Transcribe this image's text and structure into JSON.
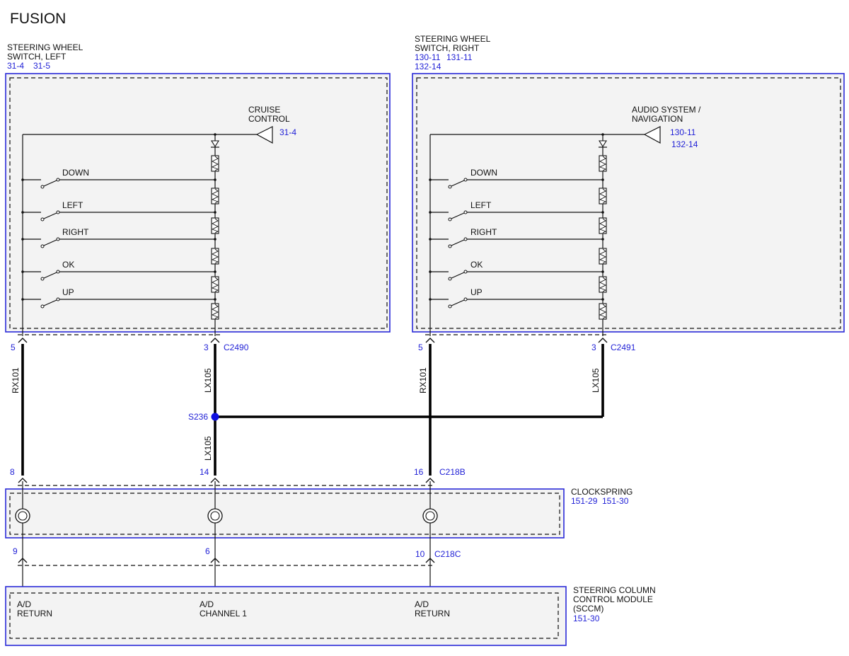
{
  "title": "FUSION",
  "colors": {
    "module_border": "#2a2ad8",
    "ref_text": "#1f1fd6",
    "splice": "#1010e0",
    "wire": "#000000",
    "module_fill": "#f3f3f3"
  },
  "left_switch": {
    "name_line1": "STEERING WHEEL",
    "name_line2": "SWITCH, LEFT",
    "refs": [
      "31-4",
      "31-5"
    ],
    "output_label_line1": "CRUISE",
    "output_label_line2": "CONTROL",
    "output_ref": "31-4",
    "buttons": [
      "DOWN",
      "LEFT",
      "RIGHT",
      "OK",
      "UP"
    ],
    "pin_return": "5",
    "pin_signal": "3",
    "connector": "C2490"
  },
  "right_switch": {
    "name_line1": "STEERING WHEEL",
    "name_line2": "SWITCH, RIGHT",
    "refs_line1": [
      "130-11",
      "131-11"
    ],
    "refs_line2": [
      "132-14"
    ],
    "output_label_line1": "AUDIO SYSTEM /",
    "output_label_line2": "NAVIGATION",
    "output_refs": [
      "130-11",
      "132-14"
    ],
    "buttons": [
      "DOWN",
      "LEFT",
      "RIGHT",
      "OK",
      "UP"
    ],
    "pin_return": "5",
    "pin_signal": "3",
    "connector": "C2491"
  },
  "circuits": {
    "return": "RX101",
    "signal": "LX105"
  },
  "splice": {
    "name": "S236"
  },
  "c218b": {
    "connector": "C218B",
    "pins": [
      "8",
      "14",
      "16"
    ]
  },
  "clockspring": {
    "name": "CLOCKSPRING",
    "refs": [
      "151-29",
      "151-30"
    ]
  },
  "c218c": {
    "connector": "C218C",
    "pins": [
      "9",
      "6",
      "10"
    ]
  },
  "sccm": {
    "name_lines": [
      "STEERING COLUMN",
      "CONTROL MODULE",
      "(SCCM)"
    ],
    "ref": "151-30",
    "inputs": [
      {
        "line1": "A/D",
        "line2": "RETURN"
      },
      {
        "line1": "A/D",
        "line2": "CHANNEL 1"
      },
      {
        "line1": "A/D",
        "line2": "RETURN"
      }
    ]
  }
}
